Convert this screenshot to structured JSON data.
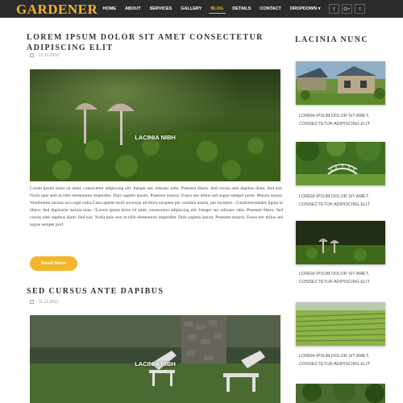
{
  "brand": {
    "logo": "GARDENER",
    "accent": "#f3b52a"
  },
  "nav": {
    "items": [
      {
        "label": "HOME"
      },
      {
        "label": "ABOUT"
      },
      {
        "label": "SERVICES"
      },
      {
        "label": "GALLERY"
      },
      {
        "label": "BLOG",
        "active": true
      },
      {
        "label": "DETAILS"
      },
      {
        "label": "CONTACT"
      },
      {
        "label": "DROPDOWN ▾"
      }
    ]
  },
  "social": {
    "facebook": "f",
    "google": "G+",
    "twitter": "t"
  },
  "posts": [
    {
      "title": "LOREM IPSUM DOLOR SIT AMET CONSECTETUR ADIPISCING ELIT",
      "date": "12.10.2016",
      "image_caption": "LACINIA NIBH",
      "body": "Lorem ipsum dolor sit amet, consectetur adipiscing elit. Integer nec odionec odio. Praesent libero. Sed cursus ante dapibus diam. Sed nisi. Nulla quis sem at nibh elementum imperdiet. Duis sagittis ipsum. Praesent mauris. Fusce nec tellus sed augue semper porta. Mauris massa. Vestibulum lacinia arcu eget nulla.Class aptent taciti sociosqu ad litora torquent per conubia nostra, per inceptos . Curabiturnodales ligula in libero. Sed dignissim lacinia nunc. !Lorem ipsum dolor sit amet, consectetur adipiscing elit. Integer nec odionec odio. Praesent libero. Sed cursus ante dapibus diam. Sed nisi. Nulla quis sem at nibh elementum imperdiet. Duis sagittis ipsum. Praesent mauris. Fusce nec tellus sed augue semper port.",
      "button": "Read More"
    },
    {
      "title": "SED CURSUS ANTE DAPIBUS",
      "date": "11.12.2011",
      "image_caption": "LACINIA NIBH"
    }
  ],
  "sidebar": {
    "title": "LACINIA NUNC",
    "items": [
      {
        "text": "LOREM IPSUM DOLOR SIT AMET, CONSECTETUR ADIPISCING ELIT"
      },
      {
        "text": "LOREM IPSUM DOLOR SIT AMET, CONSECTETUR ADIPISCING ELIT"
      },
      {
        "text": "LOREM IPSUM DOLOR SIT AMET, CONSECTETUR ADIPISCING ELIT"
      },
      {
        "text": "LOREM IPSUM DOLOR SIT AMET, CONSECTETUR ADIPISCING ELIT"
      }
    ]
  }
}
